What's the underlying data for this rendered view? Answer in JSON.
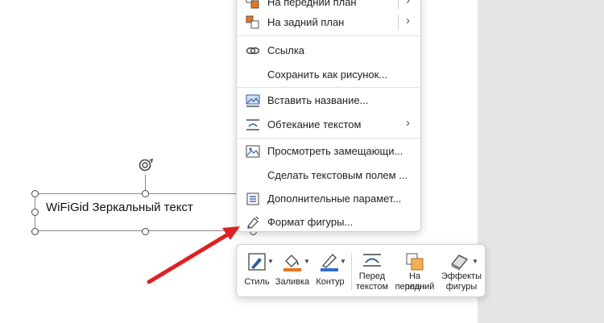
{
  "shape": {
    "text": "WiFiGid Зеркальный текст"
  },
  "context_menu": {
    "items": [
      {
        "id": "bring-forward",
        "label": "На передний план",
        "icon": "bring-forward-icon",
        "submenu": true
      },
      {
        "id": "send-backward",
        "label": "На задний план",
        "icon": "send-backward-icon",
        "submenu": true
      },
      {
        "id": "link",
        "label": "Ссылка",
        "icon": "link-icon",
        "submenu": false
      },
      {
        "id": "save-as-picture",
        "label": "Сохранить как рисунок...",
        "icon": "",
        "submenu": false
      },
      {
        "id": "insert-caption",
        "label": "Вставить название...",
        "icon": "caption-icon",
        "submenu": false
      },
      {
        "id": "wrap-text",
        "label": "Обтекание текстом",
        "icon": "wrap-text-icon",
        "submenu": true
      },
      {
        "id": "alt-text",
        "label": "Просмотреть замещающи...",
        "icon": "alt-text-icon",
        "submenu": false
      },
      {
        "id": "make-textbox",
        "label": "Сделать текстовым полем ...",
        "icon": "",
        "submenu": false
      },
      {
        "id": "more-layout",
        "label": "Дополнительные парамет...",
        "icon": "layout-options-icon",
        "submenu": false
      },
      {
        "id": "format-shape",
        "label": "Формат фигуры...",
        "icon": "format-shape-icon",
        "submenu": false
      }
    ]
  },
  "mini_toolbar": {
    "style": "Стиль",
    "fill": "Заливка",
    "outline": "Контур",
    "wrap_line1": "Перед",
    "wrap_line2": "текстом",
    "front_line1": "На передний",
    "front_line2": "план",
    "effects_line1": "Эффекты",
    "effects_line2": "фигуры"
  },
  "colors": {
    "fill_accent": "#e8741c",
    "outline_accent": "#2f6fd1",
    "annotation_arrow": "#e02020",
    "icon_blue": "#2f5f9e"
  }
}
